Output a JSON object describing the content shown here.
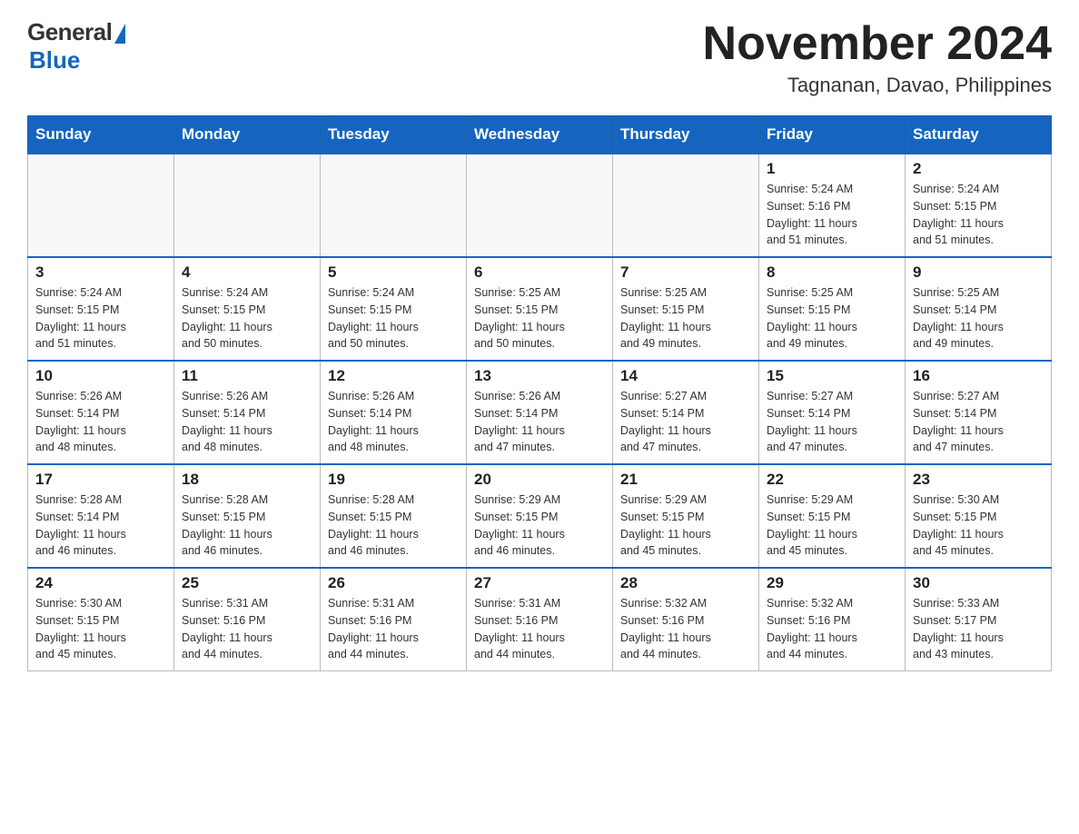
{
  "logo": {
    "general": "General",
    "blue": "Blue"
  },
  "header": {
    "month": "November 2024",
    "location": "Tagnanan, Davao, Philippines"
  },
  "weekdays": [
    "Sunday",
    "Monday",
    "Tuesday",
    "Wednesday",
    "Thursday",
    "Friday",
    "Saturday"
  ],
  "weeks": [
    [
      {
        "day": "",
        "info": ""
      },
      {
        "day": "",
        "info": ""
      },
      {
        "day": "",
        "info": ""
      },
      {
        "day": "",
        "info": ""
      },
      {
        "day": "",
        "info": ""
      },
      {
        "day": "1",
        "info": "Sunrise: 5:24 AM\nSunset: 5:16 PM\nDaylight: 11 hours\nand 51 minutes."
      },
      {
        "day": "2",
        "info": "Sunrise: 5:24 AM\nSunset: 5:15 PM\nDaylight: 11 hours\nand 51 minutes."
      }
    ],
    [
      {
        "day": "3",
        "info": "Sunrise: 5:24 AM\nSunset: 5:15 PM\nDaylight: 11 hours\nand 51 minutes."
      },
      {
        "day": "4",
        "info": "Sunrise: 5:24 AM\nSunset: 5:15 PM\nDaylight: 11 hours\nand 50 minutes."
      },
      {
        "day": "5",
        "info": "Sunrise: 5:24 AM\nSunset: 5:15 PM\nDaylight: 11 hours\nand 50 minutes."
      },
      {
        "day": "6",
        "info": "Sunrise: 5:25 AM\nSunset: 5:15 PM\nDaylight: 11 hours\nand 50 minutes."
      },
      {
        "day": "7",
        "info": "Sunrise: 5:25 AM\nSunset: 5:15 PM\nDaylight: 11 hours\nand 49 minutes."
      },
      {
        "day": "8",
        "info": "Sunrise: 5:25 AM\nSunset: 5:15 PM\nDaylight: 11 hours\nand 49 minutes."
      },
      {
        "day": "9",
        "info": "Sunrise: 5:25 AM\nSunset: 5:14 PM\nDaylight: 11 hours\nand 49 minutes."
      }
    ],
    [
      {
        "day": "10",
        "info": "Sunrise: 5:26 AM\nSunset: 5:14 PM\nDaylight: 11 hours\nand 48 minutes."
      },
      {
        "day": "11",
        "info": "Sunrise: 5:26 AM\nSunset: 5:14 PM\nDaylight: 11 hours\nand 48 minutes."
      },
      {
        "day": "12",
        "info": "Sunrise: 5:26 AM\nSunset: 5:14 PM\nDaylight: 11 hours\nand 48 minutes."
      },
      {
        "day": "13",
        "info": "Sunrise: 5:26 AM\nSunset: 5:14 PM\nDaylight: 11 hours\nand 47 minutes."
      },
      {
        "day": "14",
        "info": "Sunrise: 5:27 AM\nSunset: 5:14 PM\nDaylight: 11 hours\nand 47 minutes."
      },
      {
        "day": "15",
        "info": "Sunrise: 5:27 AM\nSunset: 5:14 PM\nDaylight: 11 hours\nand 47 minutes."
      },
      {
        "day": "16",
        "info": "Sunrise: 5:27 AM\nSunset: 5:14 PM\nDaylight: 11 hours\nand 47 minutes."
      }
    ],
    [
      {
        "day": "17",
        "info": "Sunrise: 5:28 AM\nSunset: 5:14 PM\nDaylight: 11 hours\nand 46 minutes."
      },
      {
        "day": "18",
        "info": "Sunrise: 5:28 AM\nSunset: 5:15 PM\nDaylight: 11 hours\nand 46 minutes."
      },
      {
        "day": "19",
        "info": "Sunrise: 5:28 AM\nSunset: 5:15 PM\nDaylight: 11 hours\nand 46 minutes."
      },
      {
        "day": "20",
        "info": "Sunrise: 5:29 AM\nSunset: 5:15 PM\nDaylight: 11 hours\nand 46 minutes."
      },
      {
        "day": "21",
        "info": "Sunrise: 5:29 AM\nSunset: 5:15 PM\nDaylight: 11 hours\nand 45 minutes."
      },
      {
        "day": "22",
        "info": "Sunrise: 5:29 AM\nSunset: 5:15 PM\nDaylight: 11 hours\nand 45 minutes."
      },
      {
        "day": "23",
        "info": "Sunrise: 5:30 AM\nSunset: 5:15 PM\nDaylight: 11 hours\nand 45 minutes."
      }
    ],
    [
      {
        "day": "24",
        "info": "Sunrise: 5:30 AM\nSunset: 5:15 PM\nDaylight: 11 hours\nand 45 minutes."
      },
      {
        "day": "25",
        "info": "Sunrise: 5:31 AM\nSunset: 5:16 PM\nDaylight: 11 hours\nand 44 minutes."
      },
      {
        "day": "26",
        "info": "Sunrise: 5:31 AM\nSunset: 5:16 PM\nDaylight: 11 hours\nand 44 minutes."
      },
      {
        "day": "27",
        "info": "Sunrise: 5:31 AM\nSunset: 5:16 PM\nDaylight: 11 hours\nand 44 minutes."
      },
      {
        "day": "28",
        "info": "Sunrise: 5:32 AM\nSunset: 5:16 PM\nDaylight: 11 hours\nand 44 minutes."
      },
      {
        "day": "29",
        "info": "Sunrise: 5:32 AM\nSunset: 5:16 PM\nDaylight: 11 hours\nand 44 minutes."
      },
      {
        "day": "30",
        "info": "Sunrise: 5:33 AM\nSunset: 5:17 PM\nDaylight: 11 hours\nand 43 minutes."
      }
    ]
  ]
}
